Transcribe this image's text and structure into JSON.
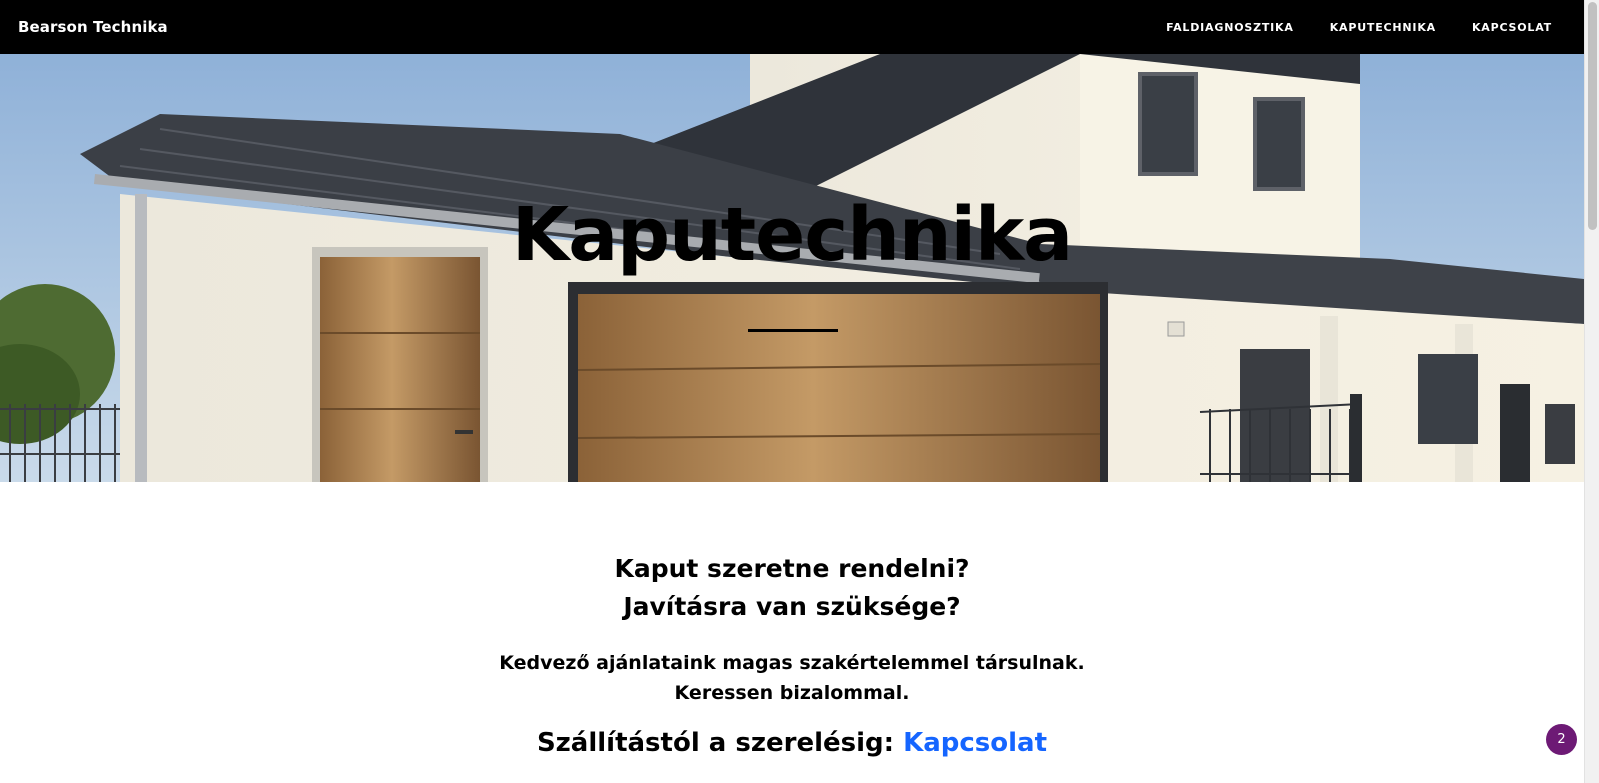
{
  "navbar": {
    "brand": "Bearson Technika",
    "links": [
      "FALDIAGNOSZTIKA",
      "KAPUTECHNIKA",
      "KAPCSOLAT"
    ]
  },
  "hero": {
    "title": "Kaputechnika"
  },
  "content": {
    "question_1": "Kaput szeretne rendelni?",
    "question_2": "Javításra van szüksége?",
    "subline_1": "Kedvező ajánlataink magas szakértelemmel társulnak.",
    "subline_2": "Keressen bizalommal.",
    "shipping_text": "Szállítástól a szerelésig:",
    "contact_link": "Kapcsolat"
  },
  "notification_badge": "2",
  "colors": {
    "navbar_bg": "#000000",
    "link_blue": "#1565ff",
    "badge_purple": "#6d1a75"
  }
}
